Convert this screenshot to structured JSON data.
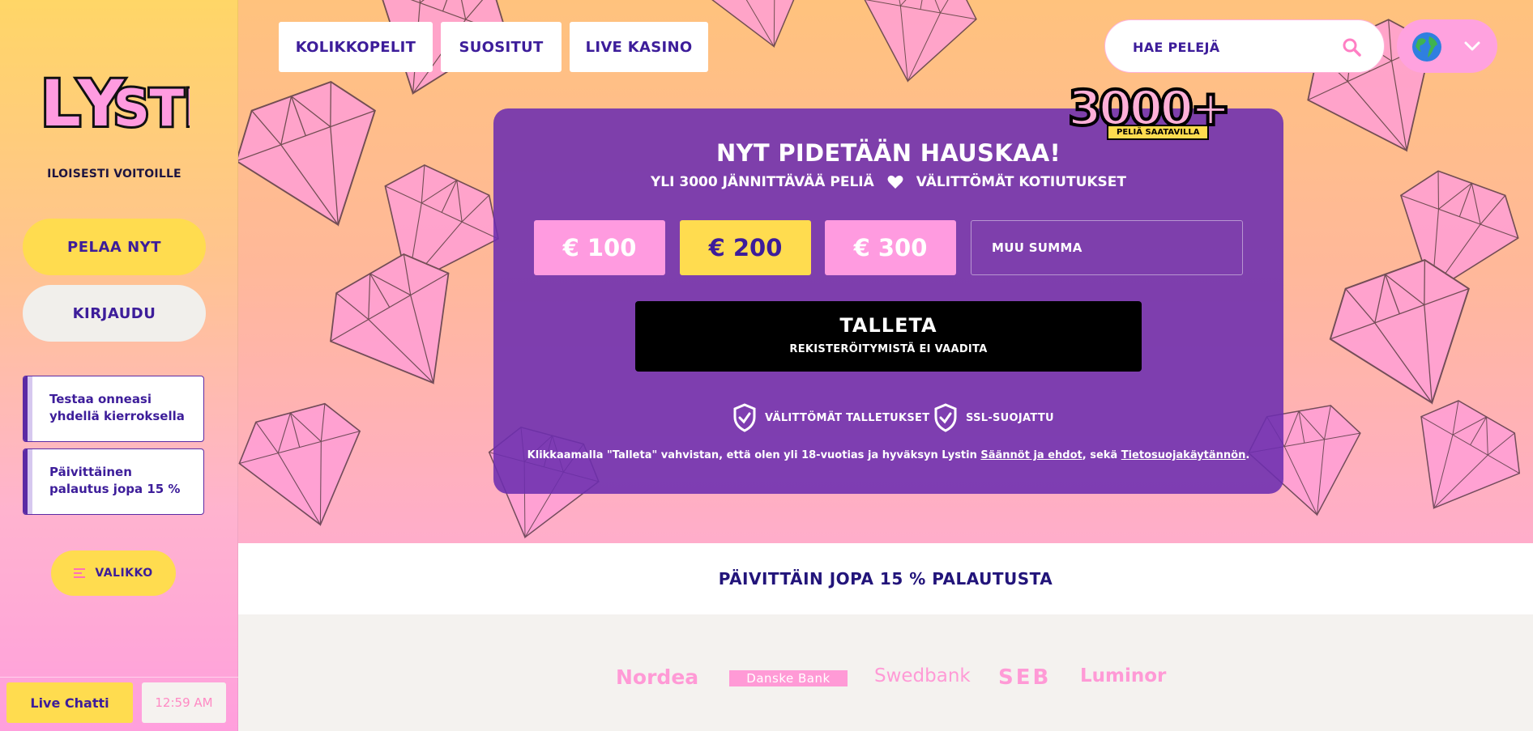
{
  "sidebar": {
    "logo_text": "LYSTI",
    "tagline": "ILOISESTI VOITOILLE",
    "play_label": "PELAA NYT",
    "login_label": "KIRJAUDU",
    "promos": [
      {
        "text": "Testaa onneasi yhdellä kierroksella"
      },
      {
        "text": "Päivittäinen palautus jopa 15 %"
      }
    ],
    "menu_label": "VALIKKO",
    "chat_label": "Live Chatti",
    "time": "12:59 AM"
  },
  "topnav": {
    "items": [
      {
        "label": "KOLIKKOPELIT"
      },
      {
        "label": "SUOSITUT"
      },
      {
        "label": "LIVE KASINO"
      }
    ],
    "search_placeholder": "HAE PELEJÄ"
  },
  "hero": {
    "badge_number": "3000+",
    "badge_tag": "PELIÄ SAATAVILLA",
    "headline": "NYT PIDETÄÄN HAUSKAA!",
    "sub_left": "YLI 3000 JÄNNITTÄVÄÄ PELIÄ",
    "sub_right": "VÄLITTÖMÄT KOTIUTUKSET",
    "amounts": [
      "€ 100",
      "€ 200",
      "€ 300"
    ],
    "selected_amount": "€ 200",
    "other_amount_label": "MUU SUMMA",
    "deposit_label": "TALLETA",
    "deposit_sub": "REKISTERÖITYMISTÄ EI VAADITA",
    "trust": [
      "VÄLITTÖMÄT TALLETUKSET",
      "SSL-SUOJATTU"
    ],
    "legal_prefix": "Klikkaamalla \"Talleta\" vahvistan, että olen yli 18-vuotias ja hyväksyn Lystin ",
    "legal_link1": "Säännöt ja ehdot",
    "legal_mid": ", sekä ",
    "legal_link2": "Tietosuojakäytännön",
    "legal_suffix": "."
  },
  "cashback_banner": "PÄIVITTÄIN JOPA 15 % PALAUTUSTA",
  "banks": [
    "Nordea",
    "Danske Bank",
    "Swedbank",
    "SEB",
    "Luminor"
  ],
  "colors": {
    "purple": "#3d1d9a",
    "yellow": "#ffdc4f",
    "pink": "#ff9be0",
    "panel": "#6c2eaf"
  }
}
